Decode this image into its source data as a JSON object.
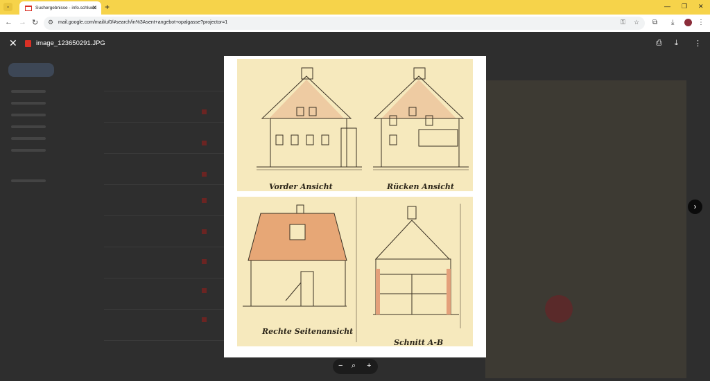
{
  "browser": {
    "tab_title": "Suchergebnisse - info.schluessel",
    "url": "mail.google.com/mail/u/0/#search/in%3Asent+angebot+opalgasse?projector=1",
    "new_tab_symbol": "+",
    "tab_search_symbol": "⌄"
  },
  "viewer": {
    "file_name": "image_123650291.JPG",
    "print_icon": "print-icon",
    "download_icon": "download-icon",
    "more_icon": "more-vert-icon"
  },
  "drawing": {
    "label_front": "Vorder Ansicht",
    "label_back": "Rücken Ansicht",
    "label_side": "Rechte Seitenansicht",
    "label_section": "Schnitt A-B"
  },
  "zoom": {
    "out_symbol": "−",
    "reset_symbol": "⌕",
    "in_symbol": "+"
  }
}
